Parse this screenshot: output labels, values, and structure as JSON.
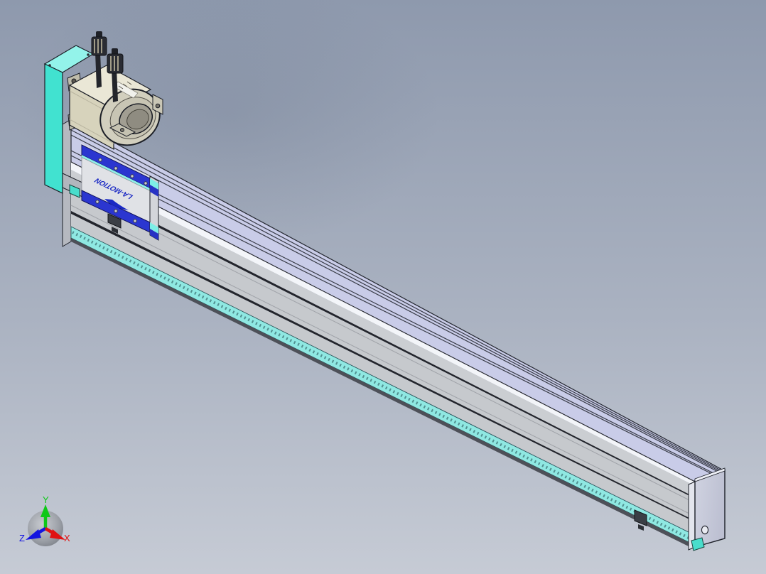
{
  "viewport": {
    "tool": "cad-3d-viewport"
  },
  "model": {
    "carriage_logo": "LA-MOTION",
    "logo_color": "#1a29c4",
    "mount_plate_color": "#41e2d0",
    "mount_plate_top_color": "#93f3ea",
    "carriage_stripe_color": "#2b36d0",
    "carriage_face_color": "#e0e2e6",
    "carriage_accent_color": "#8ff0e8",
    "rail_top_color": "#c9cce8",
    "rail_side_color": "#c6c9cd",
    "seal_strip_color": "#8fe8e2",
    "motor_body_color": "#d7d3bc",
    "motor_top_color": "#eae7d6",
    "end_cap_color": "#c9ccdb"
  },
  "triad": {
    "x_label": "X",
    "y_label": "Y",
    "z_label": "Z",
    "x_color": "#e01212",
    "y_color": "#0ec818",
    "z_color": "#1414e0"
  }
}
